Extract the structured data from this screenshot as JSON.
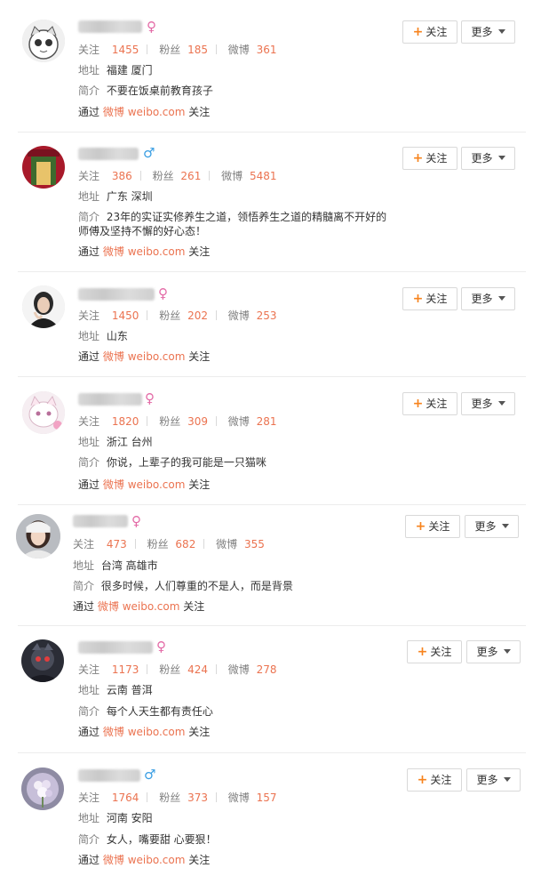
{
  "labels": {
    "follow": "关注",
    "fans": "粉丝",
    "weibo": "微博",
    "address": "地址",
    "intro": "简介",
    "via_prefix": "通过",
    "via_weibo": "微博",
    "via_domain": "weibo.com",
    "via_suffix": "关注",
    "follow_button": "关注",
    "more_button": "更多"
  },
  "users": [
    {
      "gender": "♀",
      "following": "1455",
      "fans": "185",
      "weibo": "361",
      "address": "福建 厦门",
      "intro": "不要在饭桌前教育孩子"
    },
    {
      "gender": "♂",
      "following": "386",
      "fans": "261",
      "weibo": "5481",
      "address": "广东 深圳",
      "intro": "23年的实证实修养生之道，领悟养生之道的精髓离不开好的",
      "intro2": "师傅及坚持不懈的好心态！"
    },
    {
      "gender": "♀",
      "following": "1450",
      "fans": "202",
      "weibo": "253",
      "address": "山东"
    },
    {
      "gender": "♀",
      "following": "1820",
      "fans": "309",
      "weibo": "281",
      "address": "浙江 台州",
      "intro": "你说，上辈子的我可能是一只猫咪"
    },
    {
      "gender": "♀",
      "following": "473",
      "fans": "682",
      "weibo": "355",
      "address": "台湾 高雄市",
      "intro": "很多时候，人们尊重的不是人，而是背景"
    },
    {
      "gender": "♀",
      "following": "1173",
      "fans": "424",
      "weibo": "278",
      "address": "云南 普洱",
      "intro": "每个人天生都有责任心"
    },
    {
      "gender": "♂",
      "following": "1764",
      "fans": "373",
      "weibo": "157",
      "address": "河南 安阳",
      "intro": "女人，嘴要甜 心要狠！"
    }
  ],
  "colors": {
    "accent": "#eb7350",
    "female": "#e36aa6",
    "male": "#3a9ee3",
    "plus": "#f7831d"
  }
}
